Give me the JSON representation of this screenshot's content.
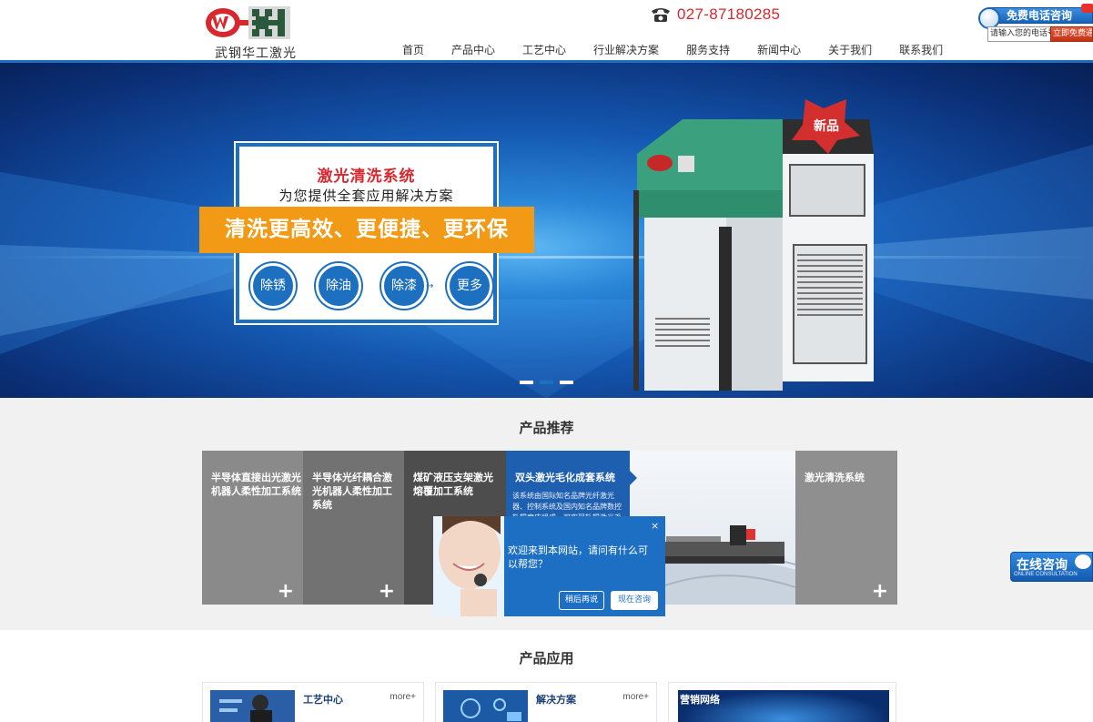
{
  "header": {
    "logo_text": "武钢华工激光",
    "phone": "027-87180285",
    "nav": [
      "首页",
      "产品中心",
      "工艺中心",
      "行业解决方案",
      "服务支持",
      "新闻中心",
      "关于我们",
      "联系我们"
    ]
  },
  "free_call": {
    "title": "免费电话咨询",
    "input_placeholder": "请输入您的电话号",
    "button": "立即免费通话"
  },
  "banner": {
    "card_title": "激光清洗系统",
    "card_subtitle": "为您提供全套应用解决方案",
    "slogan": "清洗更高效、更便捷、更环保",
    "buttons": [
      "除锈",
      "除油",
      "除漆",
      "更多"
    ],
    "badge": "新品",
    "slide_count": 3,
    "active_slide": 1
  },
  "recommend": {
    "title": "产品推荐",
    "cards": [
      {
        "label": "半导体直接出光激光机器人柔性加工系统"
      },
      {
        "label": "半导体光纤耦合激光机器人柔性加工系统"
      },
      {
        "label": "煤矿液压支架激光熔覆加工系统"
      },
      {
        "label": "双头激光毛化成套系统",
        "desc": "该系统由国际知名品牌光纤激光器、控制系统及国内知名品牌数控轧辊磨床组成，可实现轧辊激光毛"
      },
      {
        "label": "激光清洗系统"
      }
    ],
    "plus": "+"
  },
  "chat": {
    "message": "欢迎来到本网站，请问有什么可以帮您？",
    "close": "×",
    "later": "稍后再说",
    "now": "现在咨询"
  },
  "online": {
    "main": "在线咨询",
    "sub": "ONLINE CONSULTATION"
  },
  "application": {
    "title": "产品应用",
    "cards": [
      {
        "name": "工艺中心",
        "more": "more+"
      },
      {
        "name": "解决方案",
        "more": "more+"
      },
      {
        "name": "营销网络"
      }
    ]
  },
  "colors": {
    "brand_blue": "#1d6fc0",
    "accent_red": "#d9272e",
    "slogan_orange": "#f29a15"
  }
}
